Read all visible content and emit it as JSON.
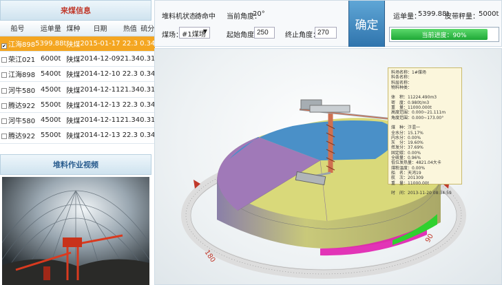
{
  "coal_panel": {
    "title": "来煤信息",
    "columns": [
      "船号",
      "运单量",
      "煤种",
      "日期",
      "热值",
      "硫分"
    ],
    "rows": [
      {
        "ship": "江海898",
        "amount": "5399.88t",
        "type": "陕煤",
        "date": "2015-01-17",
        "heat": "22.3",
        "sulfur": "0.34",
        "checked": "✔"
      },
      {
        "ship": "荣江021",
        "amount": "6000t",
        "type": "陕煤",
        "date": "2014-12-09",
        "heat": "21.34",
        "sulfur": "0.31",
        "checked": ""
      },
      {
        "ship": "江海898",
        "amount": "5400t",
        "type": "陕煤",
        "date": "2014-12-10",
        "heat": "22.3",
        "sulfur": "0.34",
        "checked": ""
      },
      {
        "ship": "河牛580",
        "amount": "4500t",
        "type": "陕煤",
        "date": "2014-12-11",
        "heat": "21.34",
        "sulfur": "0.31",
        "checked": ""
      },
      {
        "ship": "腾达922",
        "amount": "5500t",
        "type": "陕煤",
        "date": "2014-12-13",
        "heat": "22.3",
        "sulfur": "0.34",
        "checked": ""
      },
      {
        "ship": "河牛580",
        "amount": "4500t",
        "type": "陕煤",
        "date": "2014-12-11",
        "heat": "21.34",
        "sulfur": "0.31",
        "checked": ""
      },
      {
        "ship": "腾达922",
        "amount": "5500t",
        "type": "陕煤",
        "date": "2014-12-13",
        "heat": "22.3",
        "sulfur": "0.34",
        "checked": ""
      }
    ]
  },
  "video_panel": {
    "title": "堆料作业视频"
  },
  "control": {
    "status_label": "堆料机状态：",
    "status_value": "待命中",
    "angle_label": "当前角度：",
    "angle_value": "20°",
    "yard_label": "煤场：",
    "yard_value": "#1煤场",
    "start_label": "起始角度：",
    "start_value": "250",
    "end_label": "终止角度：",
    "end_value": "270",
    "confirm_label": "确定",
    "waybill_label": "运单量：",
    "waybill_value": "5399.88t",
    "belt_label": "皮带秤量：",
    "belt_value": "5000t",
    "progress_label": "当前进度：90%",
    "progress_value": 0.9
  },
  "info_panel": {
    "lines": [
      "料场名称：1#煤场",
      "料条名称：",
      "料层名称：",
      "物料种类：",
      "",
      "体　积：11224.490m3",
      "密　度：0.980t/m3",
      "重　量：11000.000t",
      "高度范围：0.000~21.111m",
      "角度范围：0.000~173.00°",
      "",
      "煤　种：汴混一",
      "全水分：15.17%",
      "内水分：0.00%",
      "灰　分：19.60%",
      "挥发分：37.69%",
      "固定碳：0.00%",
      "全硫量：0.96%",
      "低位发热量：4821.04大卡",
      "煤粉温度：0.00%",
      "船　名：天鸿19",
      "航　次：201309",
      "重　量：11000.00t",
      "",
      "时　间：2013-11-20 08:34:59"
    ]
  },
  "dial_labels": [
    "180",
    "90"
  ],
  "colors": {
    "selected_row": "#f4a621",
    "confirm_button": "#3a85c2",
    "progress": "#22b03a",
    "pile_blue": "#4a90c8",
    "pile_purple": "#a079b8",
    "pile_yellow": "#d9d97a",
    "pile_green": "#2fd12f",
    "pile_magenta": "#e01fb0"
  }
}
